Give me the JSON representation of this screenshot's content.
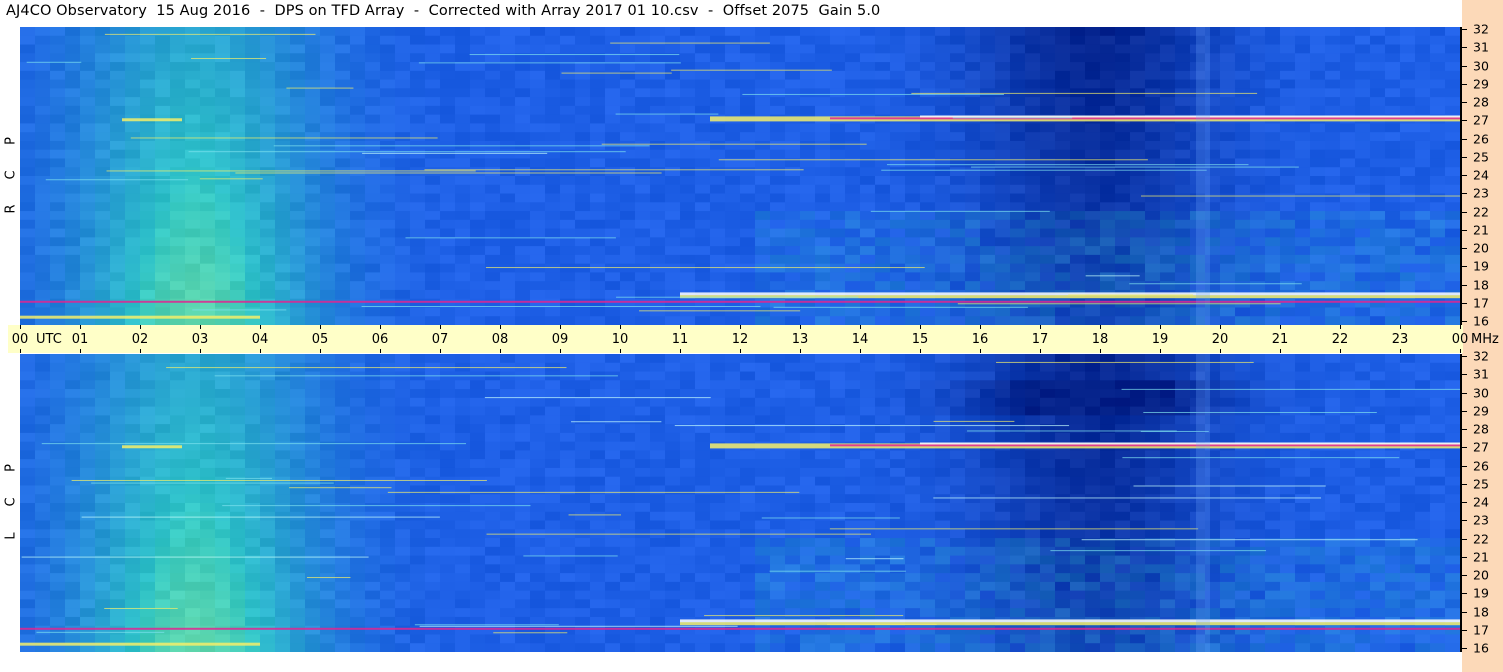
{
  "title": "AJ4CO Observatory  15 Aug 2016  -  DPS on TFD Array  -  Corrected with Array 2017 01 10.csv  -  Offset 2075  Gain 5.0",
  "time_axis": {
    "hour_labels": [
      "00",
      "01",
      "02",
      "03",
      "04",
      "05",
      "06",
      "07",
      "08",
      "09",
      "10",
      "11",
      "12",
      "13",
      "14",
      "15",
      "16",
      "17",
      "18",
      "19",
      "20",
      "21",
      "22",
      "23",
      "00"
    ],
    "utc_label": "UTC",
    "mhz_label": "MHz"
  },
  "panels": [
    {
      "id": "rcp",
      "letters": [
        "R",
        "C",
        "P"
      ]
    },
    {
      "id": "lcp",
      "letters": [
        "L",
        "C",
        "P"
      ]
    }
  ],
  "colors": {
    "background_quiet": "#1e5fe6",
    "background_warm": "#2fc7c8",
    "daytime_green": "#a8ec7a",
    "night_dark": "#001a80",
    "rfi_white": "#ffffff",
    "rfi_magenta": "#e02690",
    "rfi_yellow": "#f5ef6a",
    "time_bar": "#ffffc8",
    "freq_strip": "#fcd9b8"
  },
  "chart_data": {
    "type": "heatmap",
    "x_axis": {
      "label": "UTC",
      "range": [
        "00",
        "24"
      ],
      "ticks": [
        "00",
        "01",
        "02",
        "03",
        "04",
        "05",
        "06",
        "07",
        "08",
        "09",
        "10",
        "11",
        "12",
        "13",
        "14",
        "15",
        "16",
        "17",
        "18",
        "19",
        "20",
        "21",
        "22",
        "23",
        "00"
      ]
    },
    "y_axis": {
      "label": "MHz",
      "range": [
        16,
        32
      ],
      "ticks": [
        32,
        31,
        30,
        29,
        28,
        27,
        26,
        25,
        24,
        23,
        22,
        21,
        20,
        19,
        18,
        17,
        16
      ]
    },
    "panels": [
      "RCP",
      "LCP"
    ],
    "rfi_bands_mhz": [
      17.5,
      17.8,
      27.1,
      27.3
    ]
  }
}
